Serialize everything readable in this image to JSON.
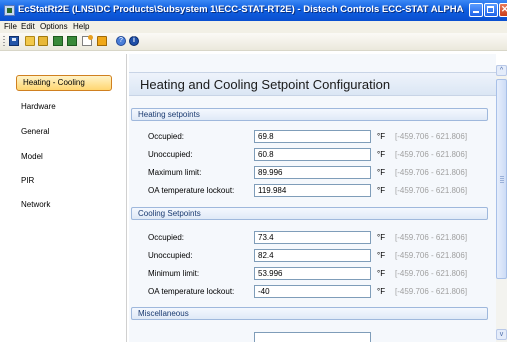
{
  "window": {
    "title": "EcStatRt2E (LNS\\DC Products\\Subsystem 1\\ECC-STAT-RT2E) - Distech Controls ECC-STAT ALPHA"
  },
  "menu": [
    "File",
    "Edit",
    "Options",
    "Help"
  ],
  "toolbar": {
    "icons": [
      "save-icon",
      "open-folder-icon",
      "open-folder-alt-icon",
      "device-icon",
      "device-alt-icon",
      "document-icon",
      "upload-icon",
      "help-icon",
      "info-icon"
    ],
    "help_glyph": "?",
    "info_glyph": "i"
  },
  "nav": {
    "items": [
      {
        "label": "Heating - Cooling",
        "selected": true
      },
      {
        "label": "Hardware"
      },
      {
        "label": "General"
      },
      {
        "label": "Model"
      },
      {
        "label": "PIR"
      },
      {
        "label": "Network"
      }
    ]
  },
  "main": {
    "title": "Heating and Cooling Setpoint Configuration",
    "sections": [
      {
        "title": "Heating setpoints",
        "rows": [
          {
            "label": "Occupied:",
            "value": "69.8",
            "unit": "°F",
            "range": "[-459.706 - 621.806]"
          },
          {
            "label": "Unoccupied:",
            "value": "60.8",
            "unit": "°F",
            "range": "[-459.706 - 621.806]"
          },
          {
            "label": "Maximum limit:",
            "value": "89.996",
            "unit": "°F",
            "range": "[-459.706 - 621.806]"
          },
          {
            "label": "OA temperature lockout:",
            "value": "119.984",
            "unit": "°F",
            "range": "[-459.706 - 621.806]"
          }
        ]
      },
      {
        "title": "Cooling Setpoints",
        "rows": [
          {
            "label": "Occupied:",
            "value": "73.4",
            "unit": "°F",
            "range": "[-459.706 - 621.806]"
          },
          {
            "label": "Unoccupied:",
            "value": "82.4",
            "unit": "°F",
            "range": "[-459.706 - 621.806]"
          },
          {
            "label": "Minimum limit:",
            "value": "53.996",
            "unit": "°F",
            "range": "[-459.706 - 621.806]"
          },
          {
            "label": "OA temperature lockout:",
            "value": "-40",
            "unit": "°F",
            "range": "[-459.706 - 621.806]"
          }
        ]
      },
      {
        "title": "Miscellaneous",
        "rows": []
      }
    ]
  },
  "scrollbar": {
    "up_glyph": "^",
    "down_glyph": "v"
  }
}
